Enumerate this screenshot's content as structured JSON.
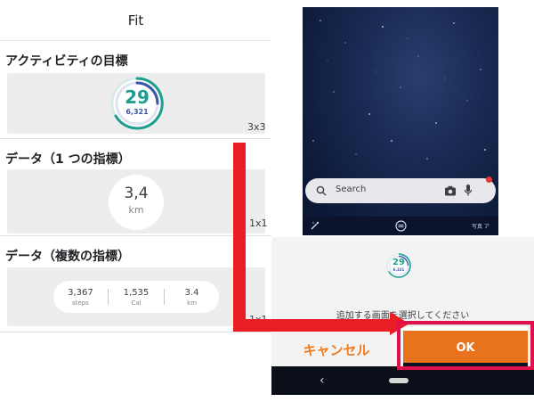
{
  "left_panel": {
    "app_title": "Fit",
    "sections": [
      {
        "heading": "アクティビティの目標",
        "size": "3x3"
      },
      {
        "heading": "データ（1 つの指標）",
        "size": "1x1"
      },
      {
        "heading": "データ（複数の指標）",
        "size": "1x1"
      }
    ],
    "activity_goal": {
      "value": "29",
      "steps": "6,321"
    },
    "single_metric": {
      "value": "3,4",
      "unit": "km"
    },
    "multi_metrics": [
      {
        "value": "3,367",
        "unit": "steps"
      },
      {
        "value": "1,535",
        "unit": "Cal"
      },
      {
        "value": "3.4",
        "unit": "km"
      }
    ]
  },
  "phone": {
    "search": {
      "placeholder": "Search"
    },
    "preview": {
      "value": "29",
      "steps": "6,321"
    },
    "prompt": "追加する画面を選択してください",
    "buttons": {
      "cancel": "キャンセル",
      "ok": "OK"
    },
    "dock_label": "写真 ア"
  },
  "colors": {
    "accent_orange": "#e8731c",
    "annotation_red": "#ea1c24",
    "ring_teal": "#1e9e8f",
    "ring_blue": "#3a56a8"
  }
}
